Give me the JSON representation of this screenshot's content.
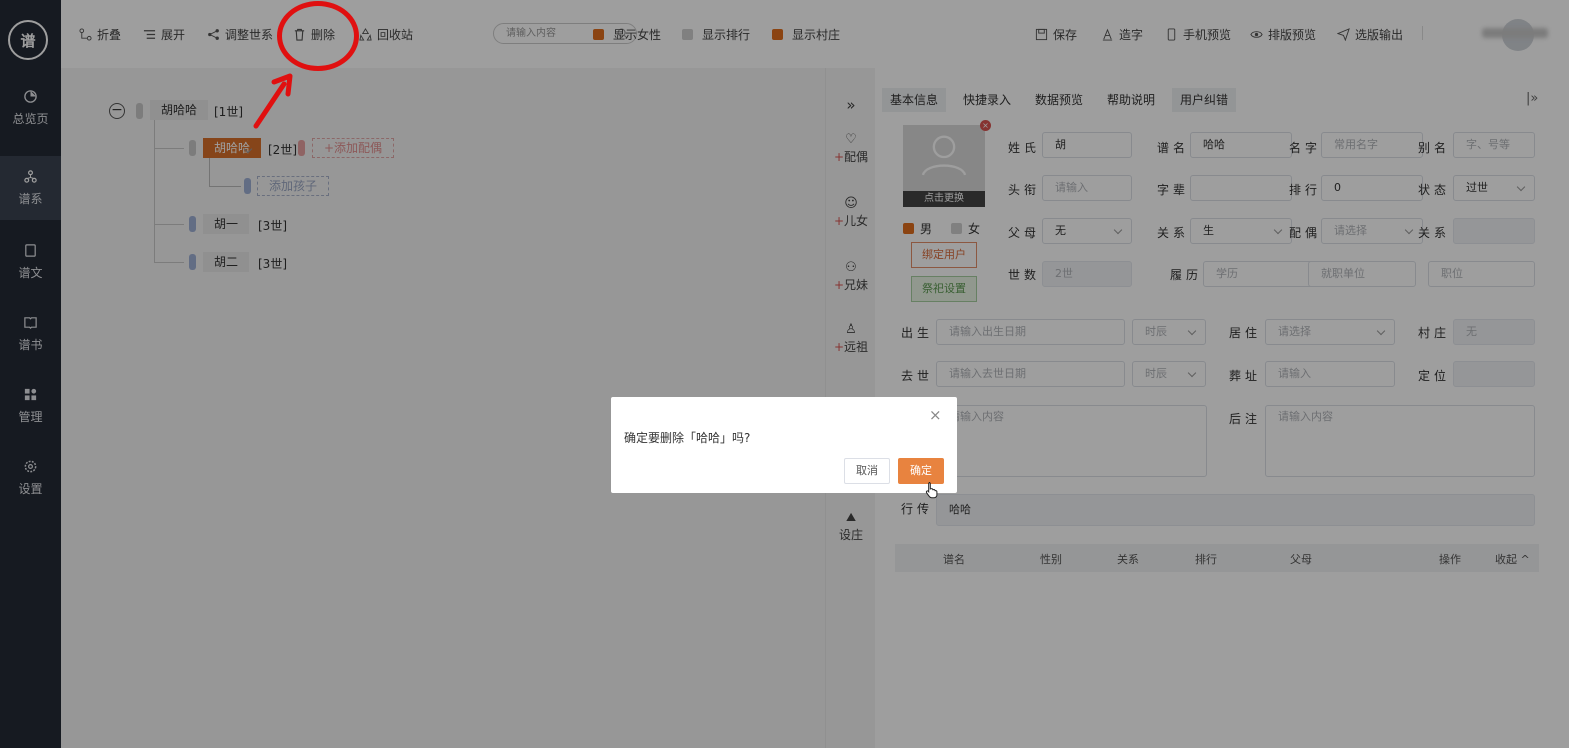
{
  "sidebar": {
    "logo_text": "谱",
    "items": [
      {
        "label": "总览页",
        "icon": "pie-chart-icon"
      },
      {
        "label": "谱系",
        "icon": "tree-icon"
      },
      {
        "label": "谱文",
        "icon": "document-icon"
      },
      {
        "label": "谱书",
        "icon": "book-icon"
      },
      {
        "label": "管理",
        "icon": "grid-icon"
      },
      {
        "label": "设置",
        "icon": "gear-icon"
      }
    ]
  },
  "toolbar": {
    "fold": "折叠",
    "expand": "展开",
    "adjust": "调整世系",
    "delete": "删除",
    "recycle": "回收站",
    "search_placeholder": "请输入内容",
    "show_female": "显示女性",
    "show_rank": "显示排行",
    "show_village": "显示村庄",
    "save": "保存",
    "create_char": "造字",
    "mobile_preview": "手机预览",
    "layout_preview": "排版预览",
    "export": "选版输出"
  },
  "tree": {
    "root": {
      "name": "胡哈哈",
      "gen": "[1世]"
    },
    "child": {
      "name": "胡哈哈",
      "gen": "[2世]"
    },
    "add_spouse": "+添加配偶",
    "add_child": "添加孩子",
    "sib1": {
      "name": "胡一",
      "gen": "[3世]"
    },
    "sib2": {
      "name": "胡二",
      "gen": "[3世]"
    }
  },
  "side_actions": [
    "配偶",
    "儿女",
    "兄妹",
    "远祖",
    "设庄"
  ],
  "tabs": [
    "基本信息",
    "快捷录入",
    "数据预览",
    "帮助说明",
    "用户纠错"
  ],
  "form": {
    "photo_change": "点击更换",
    "male": "男",
    "female": "女",
    "bind_user": "绑定用户",
    "ritual_settings": "祭祀设置",
    "surname_label": "姓氏",
    "surname": "胡",
    "pu_name_label": "谱名",
    "pu_name": "哈哈",
    "given_name_label": "名字",
    "given_name_ph": "常用名字",
    "alias_label": "别名",
    "alias_ph": "字、号等",
    "title_label": "头衔",
    "title_ph": "请输入",
    "zi_label": "字辈",
    "rank_label": "排行",
    "rank": "0",
    "status_label": "状态",
    "status": "过世",
    "parents_label": "父母",
    "parents": "无",
    "relation_label": "关系",
    "relation": "生",
    "spouse_label": "配偶",
    "spouse_ph": "请选择",
    "relation2_label": "关系",
    "gen_label": "世数",
    "gen_value": "2世",
    "resume_label": "履历",
    "resume_ph": "学历",
    "job_ph": "就职单位",
    "post_ph": "职位",
    "birth_label": "出生",
    "birth_ph": "请输入出生日期",
    "time_ph": "时辰",
    "residence_label": "居住",
    "residence_ph": "请选择",
    "village_label": "村庄",
    "village_value": "无",
    "death_label": "去世",
    "death_ph": "请输入去世日期",
    "burial_label": "葬址",
    "burial_ph": "请输入",
    "locate_label": "定位",
    "notes_ph": "请输入内容",
    "postnote_label": "后注",
    "bio_label": "行传",
    "bio": "哈哈"
  },
  "table_headers": [
    "谱名",
    "性别",
    "关系",
    "排行",
    "父母",
    "操作",
    "收起"
  ],
  "dialog": {
    "message": "确定要删除「哈哈」吗?",
    "cancel": "取消",
    "confirm": "确定"
  }
}
